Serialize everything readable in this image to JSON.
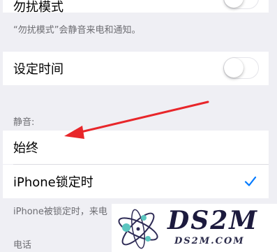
{
  "dnd": {
    "label": "勿扰模式",
    "toggle_on": false,
    "caption": "“勿扰模式”会静音来电和通知。"
  },
  "scheduled": {
    "label": "设定时间",
    "toggle_on": false
  },
  "silence": {
    "header": "静音:",
    "options": [
      {
        "label": "始终",
        "selected": false
      },
      {
        "label": "iPhone锁定时",
        "selected": true
      }
    ],
    "caption": "iPhone被锁定时，来电"
  },
  "phone_header": "电话",
  "watermark": {
    "brand": "DS2M",
    "url": "DS2M.COM"
  },
  "colors": {
    "accent": "#007aff",
    "arrow": "#e8262a"
  }
}
